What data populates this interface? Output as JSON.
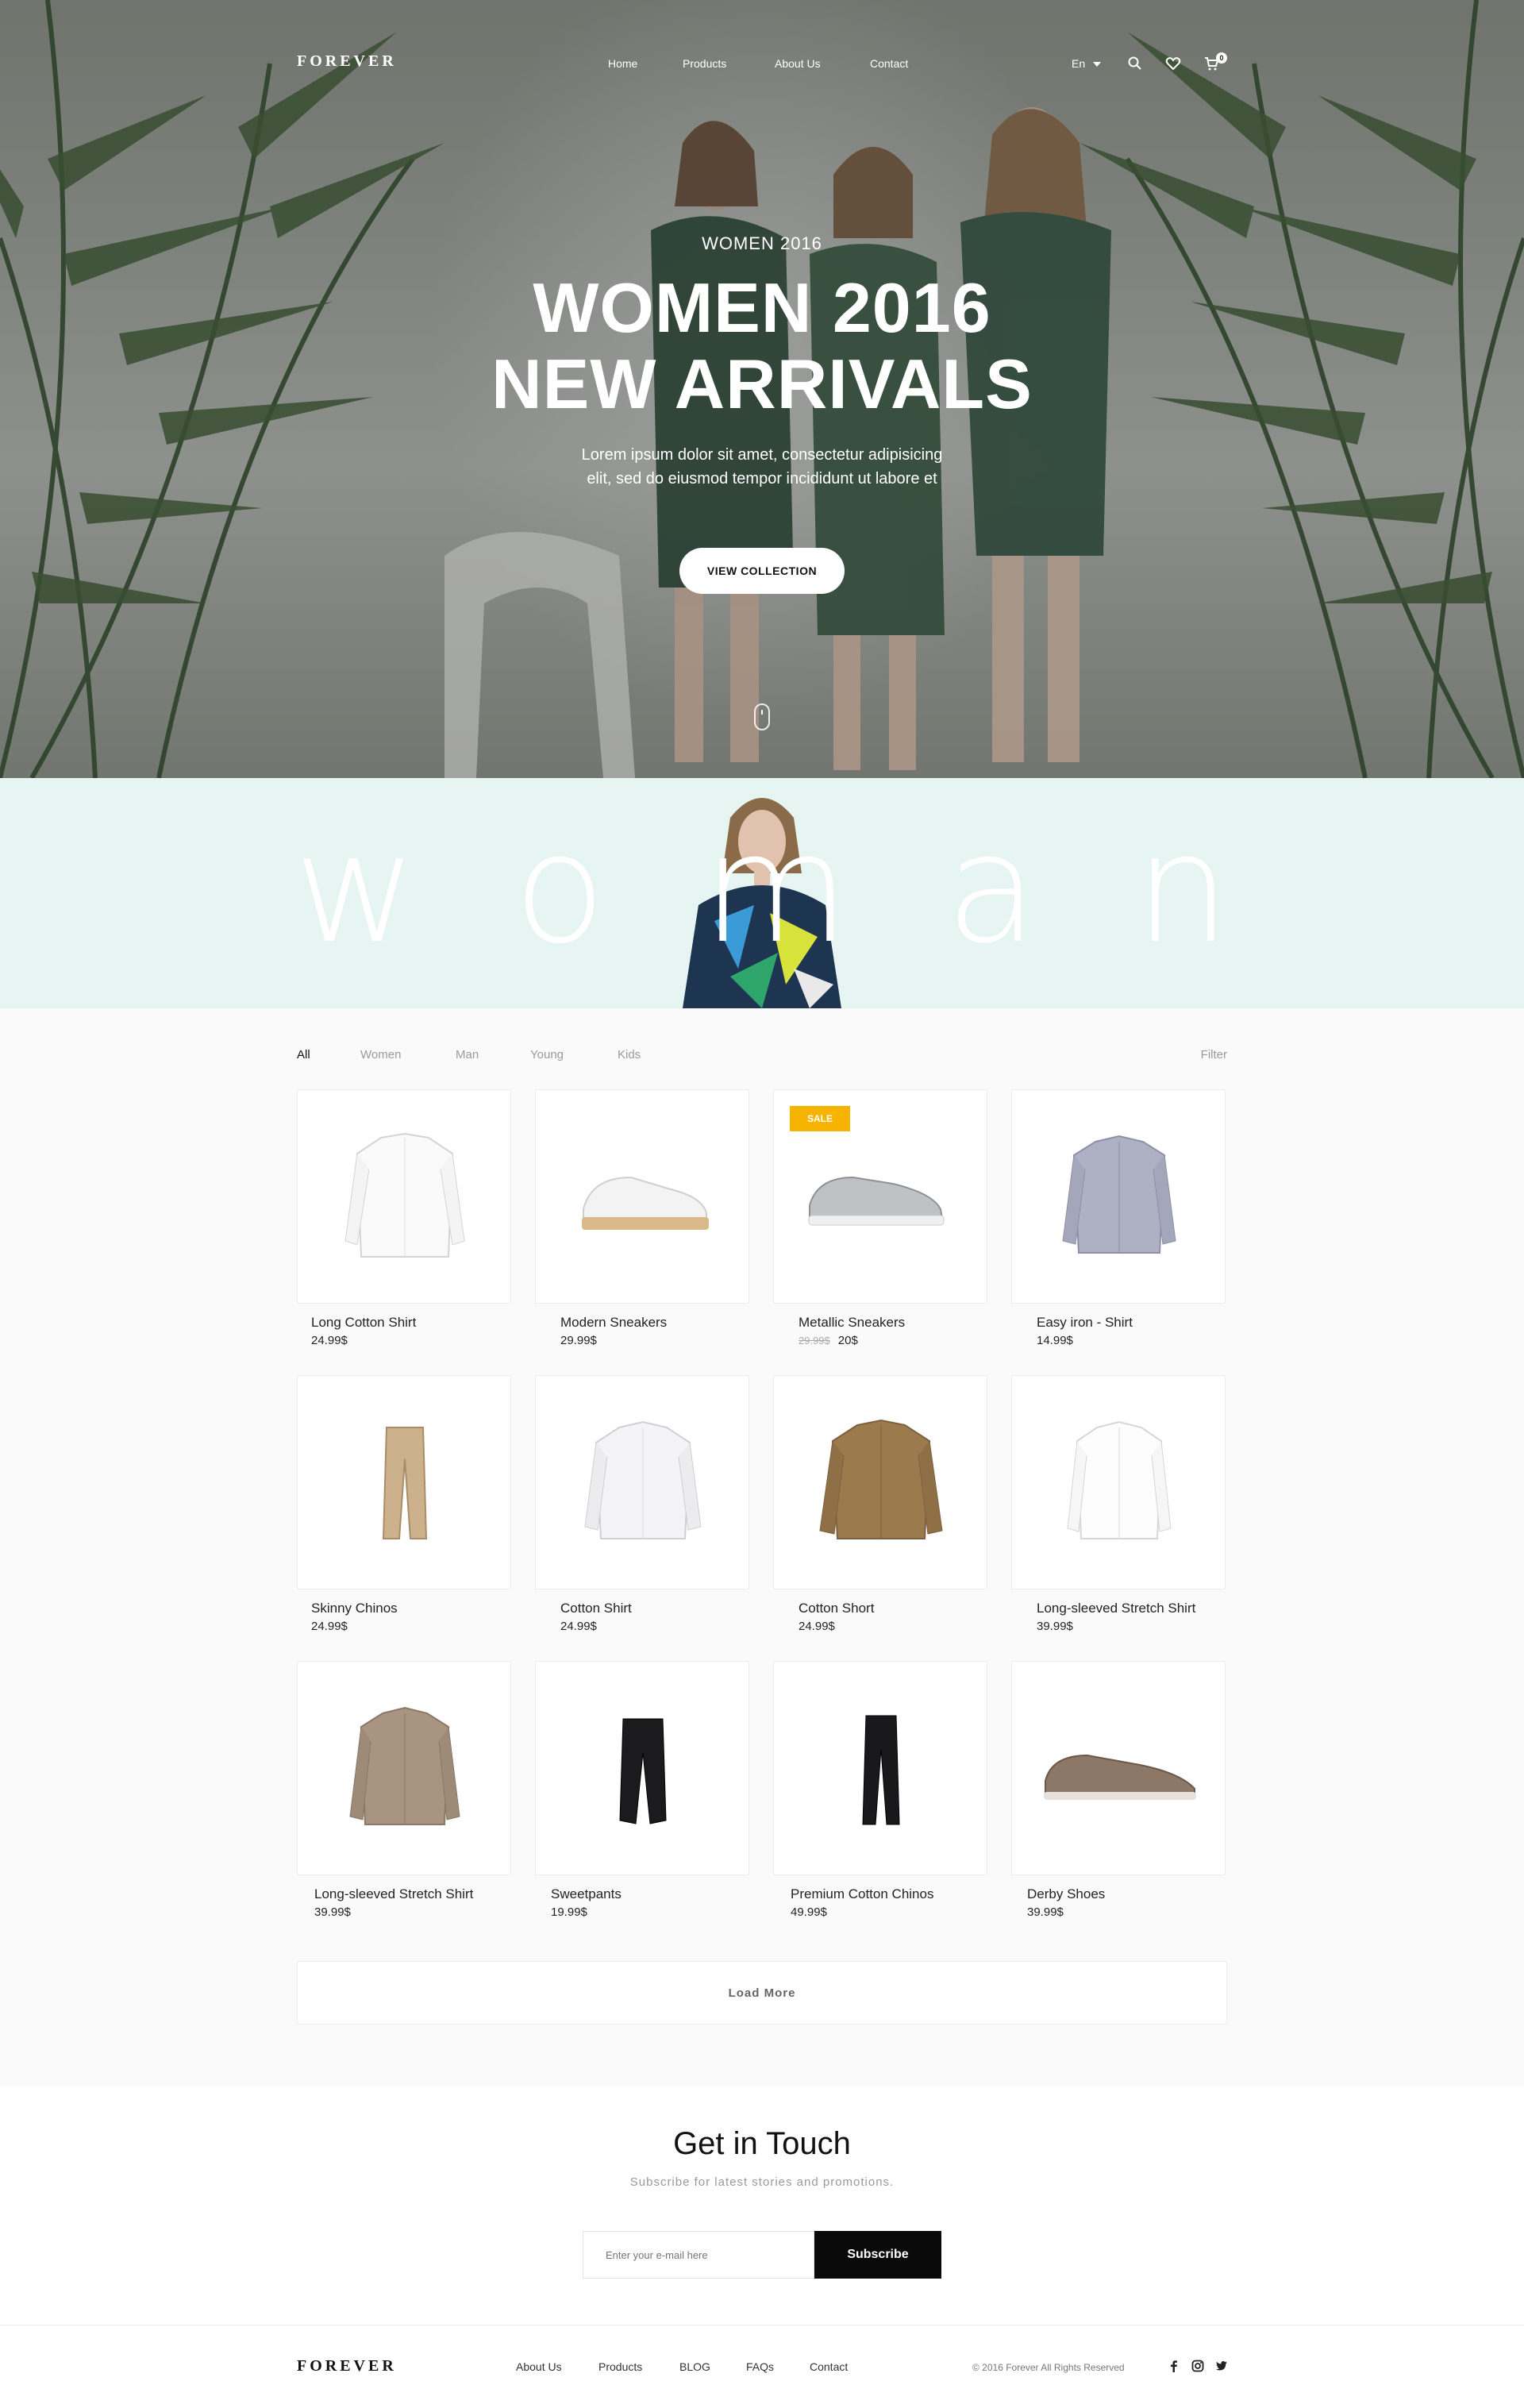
{
  "brand": "FOREVER",
  "nav": {
    "links": [
      "Home",
      "Products",
      "About Us",
      "Contact"
    ],
    "language": "En",
    "cart_count": "0",
    "icons": [
      "search-icon",
      "heart-icon",
      "cart-icon"
    ]
  },
  "hero": {
    "eyebrow": "WOMEN 2016",
    "title_line1": "WOMEN 2016",
    "title_line2": "NEW ARRIVALS",
    "desc_line1": "Lorem ipsum dolor sit amet, consectetur adipisicing",
    "desc_line2": "elit, sed do eiusmod tempor incididunt ut labore et",
    "cta": "VIEW COLLECTION"
  },
  "banner": {
    "letters": [
      "w",
      "o",
      "m",
      "a",
      "n"
    ],
    "bg_color": "#e6f4f2"
  },
  "filters": {
    "tabs": [
      "All",
      "Women",
      "Man",
      "Young",
      "Kids"
    ],
    "active": "All",
    "filter_label": "Filter"
  },
  "products": [
    {
      "name": "Long Cotton Shirt",
      "price": "24.99$",
      "image": "white-shirt"
    },
    {
      "name": "Modern Sneakers",
      "price": "29.99$",
      "image": "white-sneaker"
    },
    {
      "name": "Metallic Sneakers",
      "price": "20$",
      "old_price": "29.99$",
      "badge": "SALE",
      "image": "silver-sneaker"
    },
    {
      "name": "Easy iron - Shirt",
      "price": "14.99$",
      "image": "striped-shirt"
    },
    {
      "name": "Skinny Chinos",
      "price": "24.99$",
      "image": "beige-chinos"
    },
    {
      "name": "Cotton Shirt",
      "price": "24.99$",
      "image": "white-shirt"
    },
    {
      "name": "Cotton Short",
      "price": "24.99$",
      "image": "khaki-shirt"
    },
    {
      "name": "Long-sleeved Stretch Shirt",
      "price": "39.99$",
      "image": "white-shirt"
    },
    {
      "name": "Long-sleeved Stretch Shirt",
      "price": "39.99$",
      "image": "taupe-shirt"
    },
    {
      "name": "Sweetpants",
      "price": "19.99$",
      "image": "black-pants"
    },
    {
      "name": "Premium Cotton Chinos",
      "price": "49.99$",
      "image": "black-pants"
    },
    {
      "name": "Derby Shoes",
      "price": "39.99$",
      "image": "derby-shoe"
    }
  ],
  "load_more": "Load More",
  "newsletter": {
    "title": "Get in Touch",
    "subtitle": "Subscribe for latest stories and promotions.",
    "placeholder": "Enter your e-mail here",
    "button": "Subscribe"
  },
  "footer": {
    "logo": "FOREVER",
    "links": [
      "About Us",
      "Products",
      "BLOG",
      "FAQs",
      "Contact"
    ],
    "copyright": "© 2016 Forever All Rights Reserved",
    "social": [
      "facebook-icon",
      "instagram-icon",
      "twitter-icon"
    ]
  },
  "colors": {
    "accent": "#f6b400",
    "dark": "#0a0a0a",
    "banner": "#e6f4f2"
  }
}
